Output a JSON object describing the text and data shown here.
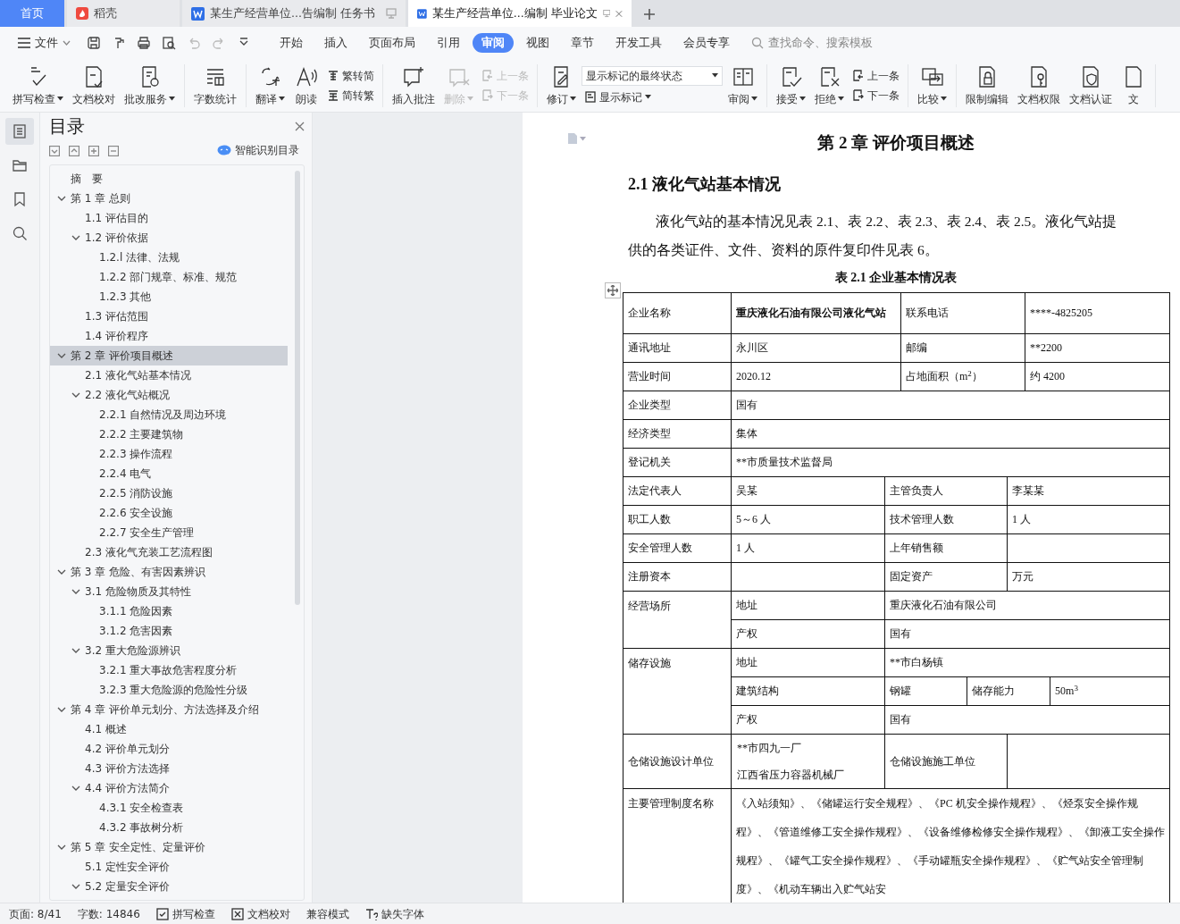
{
  "tabs": [
    {
      "kind": "home",
      "label": "首页",
      "selected": false
    },
    {
      "kind": "app",
      "label": "稻壳",
      "selected": false
    },
    {
      "kind": "doc",
      "label": "某生产经营单位...告编制 任务书",
      "selected": false
    },
    {
      "kind": "doc",
      "label": "某生产经营单位...编制 毕业论文",
      "selected": true
    }
  ],
  "menu": {
    "file": "文件",
    "items": [
      {
        "label": "开始",
        "selected": false
      },
      {
        "label": "插入",
        "selected": false
      },
      {
        "label": "页面布局",
        "selected": false
      },
      {
        "label": "引用",
        "selected": false
      },
      {
        "label": "审阅",
        "selected": true
      },
      {
        "label": "视图",
        "selected": false
      },
      {
        "label": "章节",
        "selected": false
      },
      {
        "label": "开发工具",
        "selected": false
      },
      {
        "label": "会员专享",
        "selected": false
      }
    ],
    "search": {
      "placeholder": "查找命令、搜索模板"
    }
  },
  "ribbon": [
    [
      {
        "kind": "large",
        "label": "拼写检查",
        "dropdown": true,
        "disabled": false
      },
      {
        "kind": "large",
        "label": "文档校对",
        "dropdown": false,
        "disabled": false
      },
      {
        "kind": "large",
        "label": "批改服务",
        "dropdown": true,
        "disabled": false
      }
    ],
    [
      {
        "kind": "large",
        "label": "字数统计",
        "dropdown": false,
        "disabled": false
      }
    ],
    [
      {
        "kind": "large",
        "label": "翻译",
        "dropdown": true,
        "disabled": false
      },
      {
        "kind": "large",
        "label": "朗读",
        "dropdown": false,
        "disabled": false
      },
      {
        "kind": "stack",
        "entries": [
          {
            "kind": "small",
            "label": "繁转简",
            "dropdown": false,
            "disabled": false
          },
          {
            "kind": "small",
            "label": "简转繁",
            "dropdown": false,
            "disabled": false
          }
        ]
      }
    ],
    [
      {
        "kind": "large",
        "label": "插入批注",
        "dropdown": false,
        "disabled": false
      },
      {
        "kind": "large",
        "label": "删除",
        "dropdown": true,
        "disabled": true
      },
      {
        "kind": "stack",
        "entries": [
          {
            "kind": "small",
            "label": "上一条",
            "dropdown": false,
            "disabled": true
          },
          {
            "kind": "small",
            "label": "下一条",
            "dropdown": false,
            "disabled": true
          }
        ]
      }
    ],
    [
      {
        "kind": "large",
        "label": "修订",
        "dropdown": true,
        "disabled": false
      },
      {
        "kind": "stack",
        "entries": [
          {
            "kind": "select",
            "value": "显示标记的最终状态"
          },
          {
            "kind": "small",
            "label": "显示标记",
            "dropdown": true,
            "disabled": false
          }
        ]
      },
      {
        "kind": "large",
        "label": "审阅",
        "dropdown": true,
        "disabled": false
      }
    ],
    [
      {
        "kind": "large",
        "label": "接受",
        "dropdown": true,
        "disabled": false
      },
      {
        "kind": "large",
        "label": "拒绝",
        "dropdown": true,
        "disabled": false
      },
      {
        "kind": "stack",
        "entries": [
          {
            "kind": "small",
            "label": "上一条",
            "dropdown": false,
            "disabled": false
          },
          {
            "kind": "small",
            "label": "下一条",
            "dropdown": false,
            "disabled": false
          }
        ]
      }
    ],
    [
      {
        "kind": "large",
        "label": "比较",
        "dropdown": true,
        "disabled": false
      }
    ],
    [
      {
        "kind": "large",
        "label": "限制编辑",
        "dropdown": false,
        "disabled": false
      },
      {
        "kind": "large",
        "label": "文档权限",
        "dropdown": false,
        "disabled": false
      },
      {
        "kind": "large",
        "label": "文档认证",
        "dropdown": false,
        "disabled": false
      },
      {
        "kind": "large",
        "label": "文",
        "dropdown": false,
        "disabled": false
      }
    ]
  ],
  "toc": {
    "title": "目录",
    "smart_label": "智能识别目录",
    "items": [
      {
        "label": "摘　要",
        "selected": false
      },
      {
        "label": "第 1 章  总则",
        "selected": false,
        "expanded": true,
        "children": [
          {
            "label": "1.1 评估目的",
            "selected": false
          },
          {
            "label": "1.2 评价依据",
            "selected": false,
            "expanded": true,
            "children": [
              {
                "label": "1.2.l  法律、法规",
                "selected": false
              },
              {
                "label": "1.2.2  部门规章、标准、规范",
                "selected": false
              },
              {
                "label": "1.2.3  其他",
                "selected": false
              }
            ]
          },
          {
            "label": "1.3 评估范围",
            "selected": false
          },
          {
            "label": "1.4  评价程序",
            "selected": false
          }
        ]
      },
      {
        "label": "第 2 章  评价项目概述",
        "selected": true,
        "expanded": true,
        "children": [
          {
            "label": "2.1  液化气站基本情况",
            "selected": false
          },
          {
            "label": "2.2 液化气站概况",
            "selected": false,
            "expanded": true,
            "children": [
              {
                "label": "2.2.1 自然情况及周边环境",
                "selected": false
              },
              {
                "label": "2.2.2 主要建筑物",
                "selected": false
              },
              {
                "label": "2.2.3 操作流程",
                "selected": false
              },
              {
                "label": "2.2.4 电气",
                "selected": false
              },
              {
                "label": "2.2.5 消防设施",
                "selected": false
              },
              {
                "label": "2.2.6 安全设施",
                "selected": false
              },
              {
                "label": "2.2.7 安全生产管理",
                "selected": false
              }
            ]
          },
          {
            "label": "2.3  液化气充装工艺流程图",
            "selected": false
          }
        ]
      },
      {
        "label": "第 3 章  危险、有害因素辨识",
        "selected": false,
        "expanded": true,
        "children": [
          {
            "label": " 3.1  危险物质及其特性",
            "selected": false,
            "expanded": true,
            "children": [
              {
                "label": "3.1.1 危险因素",
                "selected": false
              },
              {
                "label": "3.1.2 危害因素",
                "selected": false
              }
            ]
          },
          {
            "label": "3.2 重大危险源辨识",
            "selected": false,
            "expanded": true,
            "children": [
              {
                "label": "3.2.1 重大事故危害程度分析",
                "selected": false
              },
              {
                "label": "3.2.3 重大危险源的危险性分级",
                "selected": false
              }
            ]
          }
        ]
      },
      {
        "label": "第 4 章  评价单元划分、方法选择及介绍",
        "selected": false,
        "expanded": true,
        "children": [
          {
            "label": "4.1  概述",
            "selected": false
          },
          {
            "label": "4.2  评价单元划分",
            "selected": false
          },
          {
            "label": "4.3  评价方法选择",
            "selected": false
          },
          {
            "label": "4.4  评价方法简介",
            "selected": false,
            "expanded": true,
            "children": [
              {
                "label": "4.3.1  安全检查表",
                "selected": false
              },
              {
                "label": "4.3.2  事故树分析",
                "selected": false
              }
            ]
          }
        ]
      },
      {
        "label": "第 5 章  安全定性、定量评价",
        "selected": false,
        "expanded": true,
        "children": [
          {
            "label": "5.1 定性安全评价",
            "selected": false
          },
          {
            "label": "5.2 定量安全评价",
            "selected": false,
            "expanded": true
          }
        ]
      }
    ]
  },
  "document": {
    "chapter_title": "第 2 章  评价项目概述",
    "section_title": "2.1  液化气站基本情况",
    "paragraph": "液化气站的基本情况见表 2.1、表 2.2、表 2.3、表 2.4、表 2.5。液化气站提供的各类证件、文件、资料的原件复印件见表 6。",
    "table_caption": "表 2.1 企业基本情况表",
    "table_rows": [
      [
        {
          "text": "企业名称"
        },
        {
          "text": "重庆液化石油有限公司液化气站",
          "colspan": 2,
          "bold": true
        },
        {
          "text": "联系电话",
          "colspan": 3
        },
        {
          "text": "****-4825205",
          "colspan": 2
        }
      ],
      [
        {
          "text": "通讯地址"
        },
        {
          "text": "永川区",
          "colspan": 2
        },
        {
          "text": "邮编",
          "colspan": 3
        },
        {
          "text": "**2200",
          "colspan": 2
        }
      ],
      [
        {
          "text": "营业时间"
        },
        {
          "text": "2020.12",
          "colspan": 2
        },
        {
          "text": "占地面积（m$^{2}$）",
          "colspan": 3
        },
        {
          "text": "约 4200",
          "colspan": 2
        }
      ],
      [
        {
          "text": "企业类型"
        },
        {
          "text": "国有",
          "colspan": 7
        }
      ],
      [
        {
          "text": "经济类型"
        },
        {
          "text": "集体",
          "colspan": 7
        }
      ],
      [
        {
          "text": "登记机关"
        },
        {
          "text": "**市质量技术监督局",
          "colspan": 7
        }
      ],
      [
        {
          "text": "法定代表人"
        },
        {
          "text": "吴某"
        },
        {
          "text": "主管负责人",
          "colspan": 3
        },
        {
          "text": "李某某",
          "colspan": 3
        }
      ],
      [
        {
          "text": "职工人数"
        },
        {
          "text": "5～6 人"
        },
        {
          "text": "技术管理人数",
          "colspan": 3
        },
        {
          "text": "1 人",
          "colspan": 3
        }
      ],
      [
        {
          "text": "安全管理人数"
        },
        {
          "text": "1 人"
        },
        {
          "text": "上年销售额",
          "colspan": 3
        },
        {
          "text": "",
          "colspan": 3
        }
      ],
      [
        {
          "text": "注册资本"
        },
        {
          "text": ""
        },
        {
          "text": "固定资产",
          "colspan": 3
        },
        {
          "text": "万元",
          "colspan": 3
        }
      ],
      [
        {
          "text": "经营场所",
          "rowspan": 2
        },
        {
          "text": "地址"
        },
        {
          "text": "重庆液化石油有限公司",
          "colspan": 6
        }
      ],
      [
        {
          "text": "产权"
        },
        {
          "text": "国有",
          "colspan": 6
        }
      ],
      [
        {
          "text": "储存设施",
          "rowspan": 3
        },
        {
          "text": "地址"
        },
        {
          "text": "**市白杨镇",
          "colspan": 6
        }
      ],
      [
        {
          "text": "建筑结构"
        },
        {
          "text": "钢罐",
          "colspan": 2
        },
        {
          "text": "储存能力",
          "colspan": 3
        },
        {
          "text": "50m$^{3}$"
        }
      ],
      [
        {
          "text": "产权"
        },
        {
          "text": "国有",
          "colspan": 6
        }
      ],
      [
        {
          "text": "仓储设施设计单位"
        },
        {
          "lines": [
            "**市四九一厂",
            "江西省压力容器机械厂"
          ]
        },
        {
          "text": "仓储设施施工单位",
          "colspan": 3
        },
        {
          "text": "",
          "colspan": 3
        }
      ],
      [
        {
          "text": "主要管理制度名称"
        },
        {
          "text": "《入站须知》、《储罐运行安全规程》、《PC 机安全操作规程》、《烃泵安全操作规程》、《管道维修工安全操作规程》、《设备维修检修安全操作规程》、《卸液工安全操作规程》、《罐气工安全操作规程》、《手动罐瓶安全操作规程》、《贮气站安全管理制度》、《机动车辆出入贮气站安",
          "colspan": 7
        }
      ]
    ]
  },
  "status_bar": [
    {
      "kind": "text",
      "label": "页面: 8/41"
    },
    {
      "kind": "text",
      "label": "字数: 14846"
    },
    {
      "kind": "button",
      "label": "拼写检查"
    },
    {
      "kind": "button",
      "label": "文档校对"
    },
    {
      "kind": "text",
      "label": "兼容模式"
    },
    {
      "kind": "button",
      "label": "缺失字体"
    }
  ]
}
